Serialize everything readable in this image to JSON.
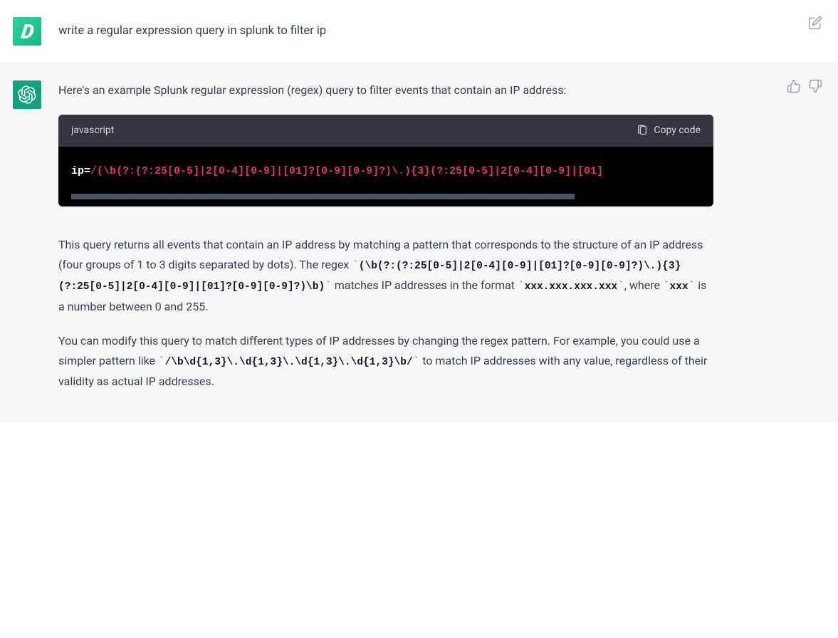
{
  "user_message": {
    "avatar_letter": "D",
    "text": "write a regular expression query in splunk to filter ip"
  },
  "assistant_message": {
    "intro": "Here's an example Splunk regular expression (regex) query to filter events that contain an IP address:",
    "code_block": {
      "language": "javascript",
      "copy_label": "Copy code",
      "code_prefix": "ip=",
      "code_regex": "/(\\b(?:(?:25[0-5]|2[0-4][0-9]|[01]?[0-9][0-9]?)\\.){3}(?:25[0-5]|2[0-4][0-9]|[01]"
    },
    "explanation": {
      "p1_a": "This query returns all events that contain an IP address by matching a pattern that corresponds to the structure of an IP address (four groups of 1 to 3 digits separated by dots). The regex ",
      "regex1": "(\\b(?:(?:25[0-5]|2[0-4][0-9]|[01]?[0-9][0-9]?)\\.){3}(?:25[0-5]|2[0-4][0-9]|[01]?[0-9][0-9]?)\\b)",
      "p1_b": " matches IP addresses in the format ",
      "format_code": "xxx.xxx.xxx.xxx",
      "p1_c": ", where ",
      "xxx_code": "xxx",
      "p1_d": " is a number between 0 and 255.",
      "p2_a": "You can modify this query to match different types of IP addresses by changing the regex pattern. For example, you could use a simpler pattern like ",
      "simple_regex": "/\\b\\d{1,3}\\.\\d{1,3}\\.\\d{1,3}\\.\\d{1,3}\\b/",
      "p2_b": " to match IP addresses with any value, regardless of their validity as actual IP addresses."
    }
  }
}
